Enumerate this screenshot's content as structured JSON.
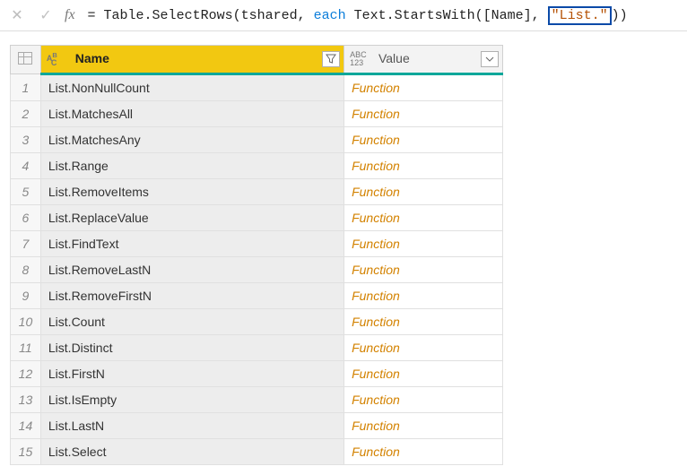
{
  "formula": {
    "pre": "= Table.SelectRows(tshared, ",
    "each": "each",
    "mid": " Text.StartsWith([Name], ",
    "highlight": "\"List.\"",
    "post": "))"
  },
  "columns": {
    "name": "Name",
    "value": "Value"
  },
  "rows": [
    {
      "n": "1",
      "name": "List.NonNullCount",
      "value": "Function"
    },
    {
      "n": "2",
      "name": "List.MatchesAll",
      "value": "Function"
    },
    {
      "n": "3",
      "name": "List.MatchesAny",
      "value": "Function"
    },
    {
      "n": "4",
      "name": "List.Range",
      "value": "Function"
    },
    {
      "n": "5",
      "name": "List.RemoveItems",
      "value": "Function"
    },
    {
      "n": "6",
      "name": "List.ReplaceValue",
      "value": "Function"
    },
    {
      "n": "7",
      "name": "List.FindText",
      "value": "Function"
    },
    {
      "n": "8",
      "name": "List.RemoveLastN",
      "value": "Function"
    },
    {
      "n": "9",
      "name": "List.RemoveFirstN",
      "value": "Function"
    },
    {
      "n": "10",
      "name": "List.Count",
      "value": "Function"
    },
    {
      "n": "11",
      "name": "List.Distinct",
      "value": "Function"
    },
    {
      "n": "12",
      "name": "List.FirstN",
      "value": "Function"
    },
    {
      "n": "13",
      "name": "List.IsEmpty",
      "value": "Function"
    },
    {
      "n": "14",
      "name": "List.LastN",
      "value": "Function"
    },
    {
      "n": "15",
      "name": "List.Select",
      "value": "Function"
    }
  ]
}
